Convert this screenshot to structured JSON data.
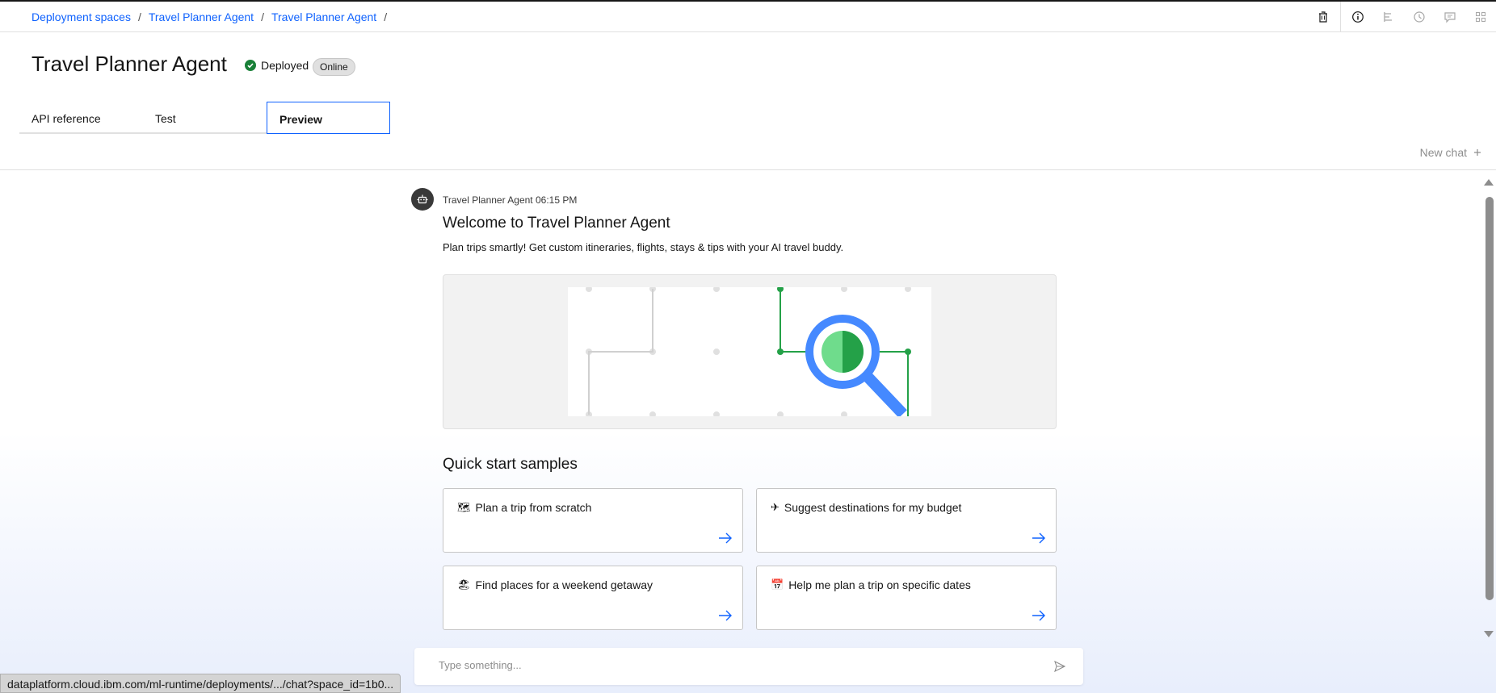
{
  "breadcrumb": {
    "items": [
      "Deployment spaces",
      "Travel Planner Agent",
      "Travel Planner Agent"
    ],
    "separator": "/"
  },
  "toolbar": {
    "icons": [
      "trash-icon",
      "info-icon",
      "tree-icon",
      "history-icon",
      "comment-icon",
      "apps-icon"
    ]
  },
  "header": {
    "title": "Travel Planner Agent",
    "status": "Deployed",
    "status_color": "#198038",
    "tag": "Online"
  },
  "tabs": [
    {
      "label": "API reference",
      "active": false
    },
    {
      "label": "Test",
      "active": false
    },
    {
      "label": "Preview",
      "active": true
    }
  ],
  "chat": {
    "new_chat_label": "New chat",
    "message": {
      "sender": "Travel Planner Agent",
      "time": "06:15 PM",
      "title": "Welcome to Travel Planner Agent",
      "subtitle": "Plan trips smartly! Get custom itineraries, flights, stays & tips with your AI travel buddy."
    },
    "quick_start": {
      "title": "Quick start samples",
      "cards": [
        {
          "emoji": "🗺",
          "label": "Plan a trip from scratch"
        },
        {
          "emoji": "✈",
          "label": "Suggest destinations for my budget"
        },
        {
          "emoji": "🏖",
          "label": "Find places for a weekend getaway"
        },
        {
          "emoji": "📅",
          "label": "Help me plan a trip on specific dates"
        }
      ]
    },
    "input_placeholder": "Type something..."
  },
  "status_bar": {
    "url": "dataplatform.cloud.ibm.com/ml-runtime/deployments/.../chat?space_id=1b0..."
  },
  "colors": {
    "link": "#0f62fe",
    "accent_green": "#24a148",
    "magnifier_blue": "#4589ff"
  }
}
